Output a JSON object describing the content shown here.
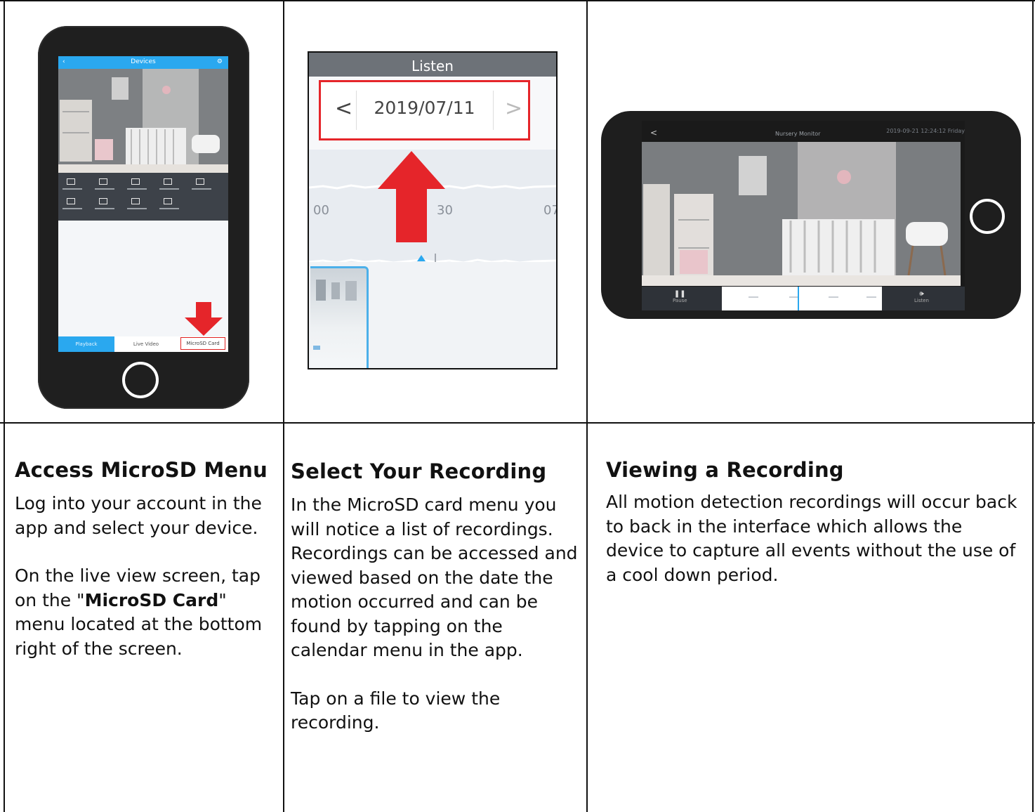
{
  "phone_app": {
    "header_title": "Devices",
    "bottom_tabs": [
      "Playback",
      "Live Video",
      "MicroSD Card"
    ]
  },
  "listen_screen": {
    "title": "Listen",
    "date": "2019/07/11",
    "prev_symbol": "<",
    "next_symbol": ">",
    "timeline_ticks": [
      "00",
      "30",
      "07"
    ]
  },
  "landscape_screen": {
    "back_symbol": "<",
    "title": "Nursery Monitor",
    "timestamp": "2019-09-21 12:24:12 Friday",
    "left_button": "Pause",
    "right_button": "Listen"
  },
  "columns": [
    {
      "title": "Access MicroSD Menu",
      "para1": "Log into your account in the app and select your device.",
      "para2_pre": "On the live view screen, tap on the \"",
      "para2_bold": "MicroSD Card",
      "para2_post": "\" menu located at the bottom right of the screen."
    },
    {
      "title": "Select Your Recording",
      "para1": "In the MicroSD card menu you will notice a list of recordings. Recordings can be accessed and viewed based on the date the motion occurred and can be found by tapping on the calendar menu in the app.",
      "para2": "Tap on a file to view the recording."
    },
    {
      "title": "Viewing a Recording",
      "para1": "All motion detection recordings will occur back to back in the interface which allows the device to capture all events without the use of a cool down period."
    }
  ],
  "colors": {
    "app_blue": "#2aa8ef",
    "highlight_red": "#e5252a",
    "phone_body": "#1f1f1f"
  }
}
